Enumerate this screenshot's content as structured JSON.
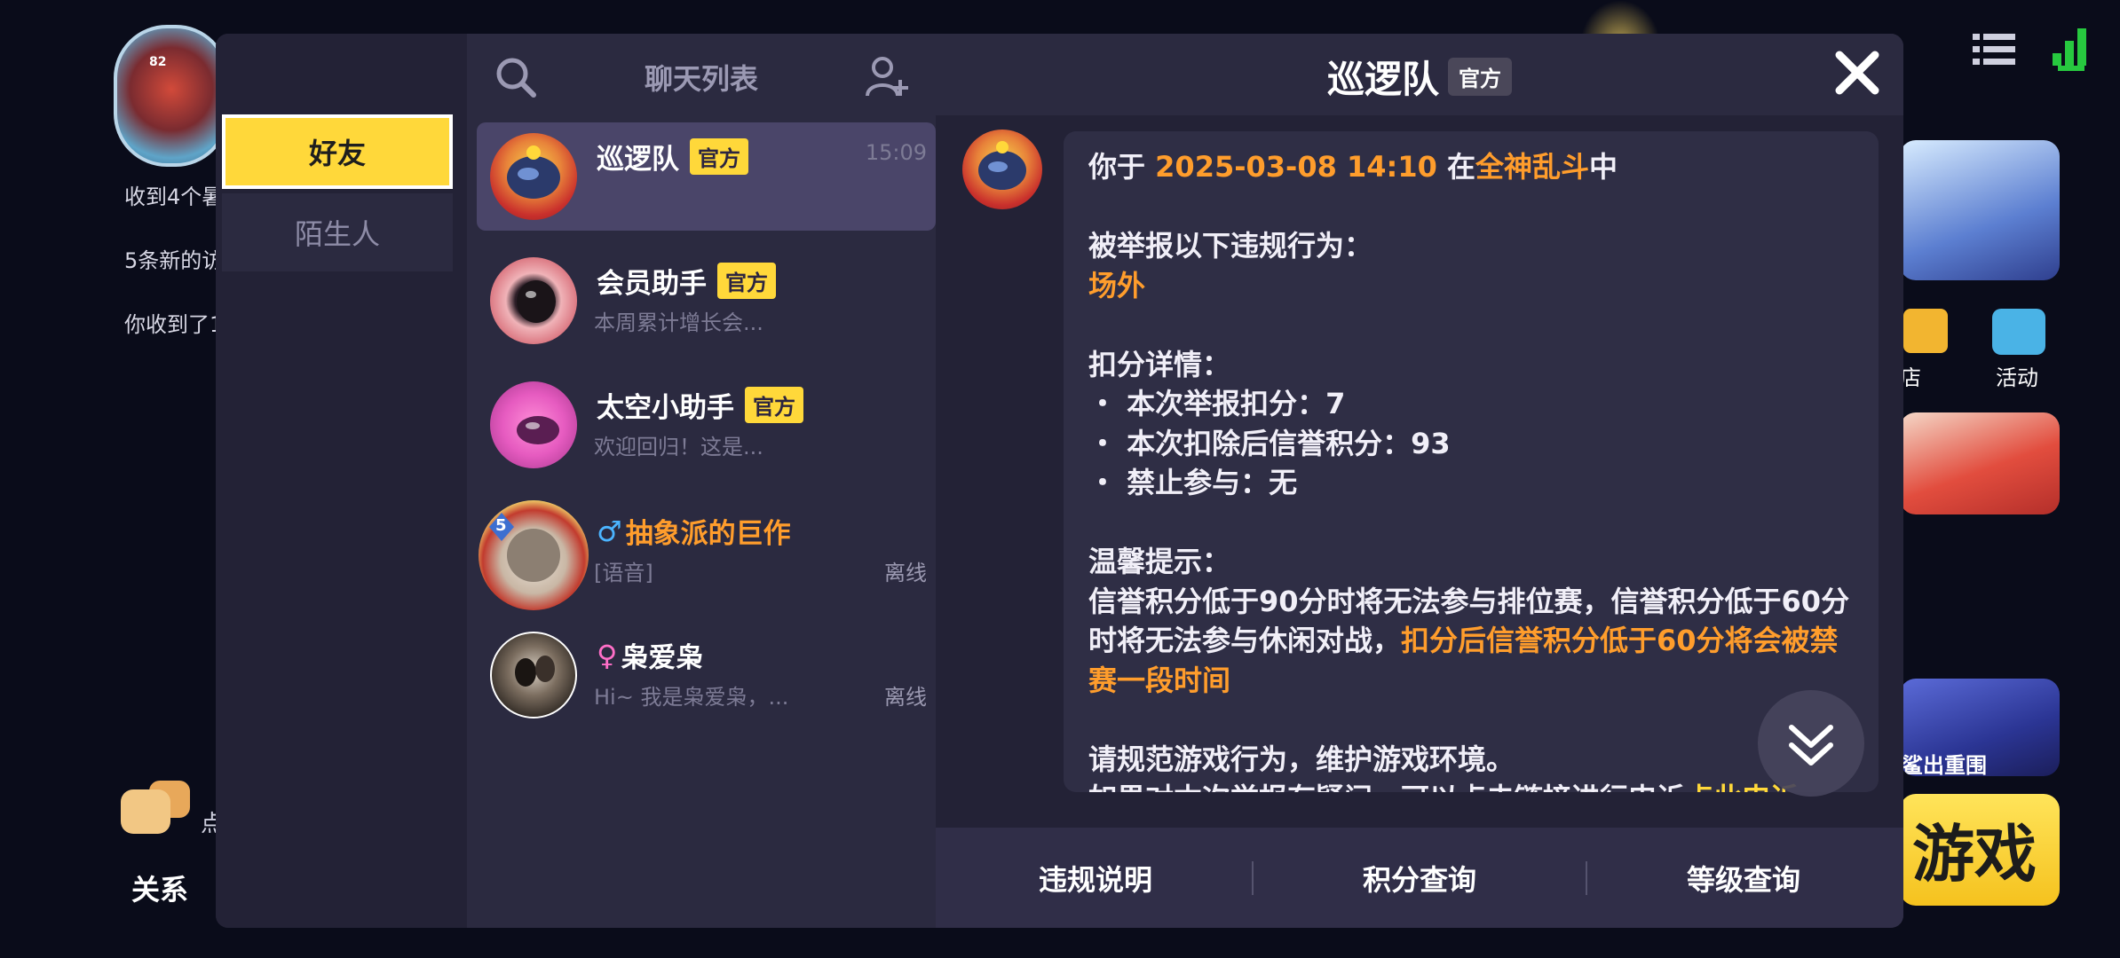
{
  "background": {
    "notices": [
      "收到4个暑",
      "5条新的访",
      "你收到了1"
    ],
    "relation_label": "关系",
    "dot_label": "点",
    "right_icons": [
      {
        "name": "store",
        "label": "店"
      },
      {
        "name": "activity",
        "label": "活动"
      }
    ],
    "card3_text": "鲨出重围",
    "card4_text": "游戏",
    "avatar_level": "82"
  },
  "sidebar": {
    "tabs": [
      {
        "label": "好友",
        "active": true
      },
      {
        "label": "陌生人",
        "active": false
      }
    ]
  },
  "chat_list": {
    "title": "聊天列表",
    "items": [
      {
        "name": "巡逻队",
        "badge": "官方",
        "time": "15:09",
        "preview": "",
        "status": ""
      },
      {
        "name": "会员助手",
        "badge": "官方",
        "time": "",
        "preview": "本周累计增长会...",
        "status": ""
      },
      {
        "name": "太空小助手",
        "badge": "官方",
        "time": "",
        "preview": "欢迎回归！这是...",
        "status": ""
      },
      {
        "name": "抽象派的巨作",
        "gender": "♂",
        "level": "5",
        "preview": "[语音]",
        "status": "离线"
      },
      {
        "name": "枭爱枭",
        "gender": "♀",
        "preview": "Hi~ 我是枭爱枭，...",
        "status": "离线"
      }
    ]
  },
  "chat": {
    "title": "巡逻队",
    "badge": "官方",
    "message": {
      "l1_pre": "你于 ",
      "l1_time": "2025-03-08 14:10",
      "l1_mid": " 在",
      "l1_mode": "全神乱斗",
      "l1_post": "中",
      "reported_label": "被举报以下违规行为：",
      "violation": "场外",
      "detail_label": "扣分详情：",
      "detail_1": "・ 本次举报扣分：7",
      "detail_2": "・ 本次扣除后信誉积分：93",
      "detail_3": "・ 禁止参与：无",
      "tip_label": "温馨提示：",
      "tip_1": "信誉积分低于90分时将无法参与排位赛，信誉积分低于60分时将无法参与休闲对战，",
      "tip_2": "扣分后信誉积分低于60分将会被禁赛一段时间",
      "regulate": "请规范游戏行为，维护游戏环境。",
      "appeal": "如果对本次举报有疑问，可以点击链接进行申诉",
      "appeal_link": "点此申诉"
    },
    "footer": [
      "违规说明",
      "积分查询",
      "等级查询"
    ]
  },
  "colors": {
    "accent_yellow": "#ffd83a",
    "highlight_orange": "#ff9d2c",
    "panel": "#232236",
    "list_bg": "#2b2a40",
    "selected_row": "#4a4569"
  }
}
